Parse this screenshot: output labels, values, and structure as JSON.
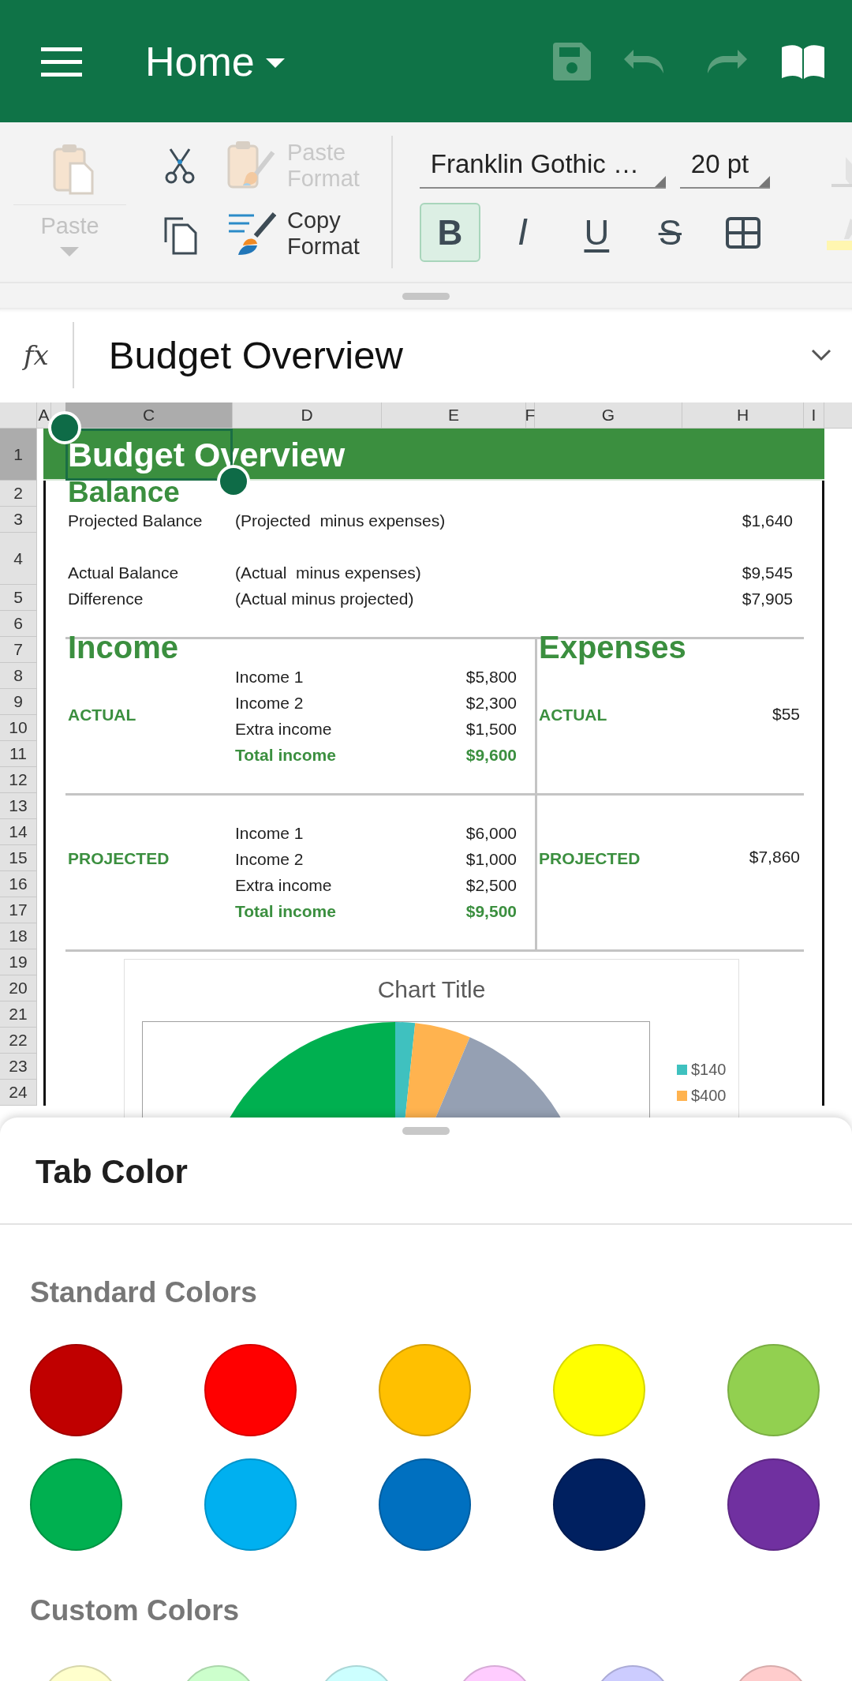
{
  "app_bar": {
    "title": "Home",
    "actions": [
      {
        "kind": "save",
        "disabled": true
      },
      {
        "kind": "undo",
        "disabled": true
      },
      {
        "kind": "redo",
        "disabled": true
      },
      {
        "kind": "read",
        "disabled": false
      }
    ]
  },
  "ribbon": {
    "paste": {
      "label": "Paste",
      "disabled": true
    },
    "tools": [
      {
        "kind": "cut",
        "disabled": false
      },
      {
        "kind": "copy",
        "disabled": false
      }
    ],
    "format_tools": [
      {
        "kind": "paste_format",
        "label": "Paste Format",
        "disabled": true
      },
      {
        "kind": "copy_format",
        "label": "Copy Format",
        "disabled": false
      }
    ],
    "font": {
      "value": "Franklin Gothic …"
    },
    "font_size": {
      "value": "20 pt"
    },
    "styles": [
      {
        "kind": "bold",
        "label": "B",
        "selected": true
      },
      {
        "kind": "italic",
        "label": "I",
        "selected": false
      },
      {
        "kind": "underline",
        "label": "U",
        "selected": false
      },
      {
        "kind": "strike",
        "label": "S",
        "selected": false
      },
      {
        "kind": "borders",
        "selected": false
      }
    ]
  },
  "formula_bar": {
    "label": "fx",
    "value": "Budget Overview"
  },
  "sheet": {
    "columns": [
      {
        "label": "A",
        "selected": false
      },
      {
        "label": "C",
        "selected": true
      },
      {
        "label": "D",
        "selected": false
      },
      {
        "label": "E",
        "selected": false
      },
      {
        "label": "F",
        "selected": false
      },
      {
        "label": "G",
        "selected": false
      },
      {
        "label": "H",
        "selected": false
      },
      {
        "label": "I",
        "selected": false
      }
    ],
    "rows": [
      {
        "label": "1",
        "selected": true
      },
      {
        "label": "2",
        "selected": false
      },
      {
        "label": "3",
        "selected": false
      },
      {
        "label": "4",
        "selected": false
      },
      {
        "label": "5",
        "selected": false
      },
      {
        "label": "6",
        "selected": false
      },
      {
        "label": "7",
        "selected": false
      },
      {
        "label": "8",
        "selected": false
      },
      {
        "label": "9",
        "selected": false
      },
      {
        "label": "10",
        "selected": false
      },
      {
        "label": "11",
        "selected": false
      },
      {
        "label": "12",
        "selected": false
      },
      {
        "label": "13",
        "selected": false
      },
      {
        "label": "14",
        "selected": false
      },
      {
        "label": "15",
        "selected": false
      },
      {
        "label": "16",
        "selected": false
      },
      {
        "label": "17",
        "selected": false
      },
      {
        "label": "18",
        "selected": false
      },
      {
        "label": "19",
        "selected": false
      },
      {
        "label": "20",
        "selected": false
      },
      {
        "label": "21",
        "selected": false
      },
      {
        "label": "22",
        "selected": false
      },
      {
        "label": "23",
        "selected": false
      },
      {
        "label": "24",
        "selected": false
      }
    ],
    "title": "Budget Overview",
    "balance": {
      "heading": "Balance",
      "lines": [
        {
          "label": "Projected Balance",
          "note": "(Projected  minus expenses)",
          "amount": "$1,640"
        },
        {
          "label": "Actual Balance",
          "note": "(Actual  minus expenses)",
          "amount": "$9,545"
        },
        {
          "label": "Difference",
          "note": "(Actual minus projected)",
          "amount": "$7,905"
        }
      ]
    },
    "income": {
      "heading": "Income",
      "groups": [
        {
          "label": "ACTUAL",
          "items": [
            {
              "label": "Income 1",
              "amount": "$5,800"
            },
            {
              "label": "Income 2",
              "amount": "$2,300"
            },
            {
              "label": "Extra income",
              "amount": "$1,500"
            }
          ],
          "total": {
            "label": "Total income",
            "amount": "$9,600"
          }
        },
        {
          "label": "PROJECTED",
          "items": [
            {
              "label": "Income 1",
              "amount": "$6,000"
            },
            {
              "label": "Income 2",
              "amount": "$1,000"
            },
            {
              "label": "Extra income",
              "amount": "$2,500"
            }
          ],
          "total": {
            "label": "Total income",
            "amount": "$9,500"
          }
        }
      ]
    },
    "expenses": {
      "heading": "Expenses",
      "groups": [
        {
          "label": "ACTUAL",
          "amount": "$55"
        },
        {
          "label": "PROJECTED",
          "amount": "$7,860"
        }
      ]
    },
    "chart": {
      "title": "Chart Title",
      "legend": [
        {
          "label": "$140",
          "color": "#3fc1bf"
        },
        {
          "label": "$400",
          "color": "#ffb34f"
        }
      ]
    }
  },
  "tab_color_sheet": {
    "title": "Tab Color",
    "sections": [
      {
        "kind": "standard",
        "heading": "Standard Colors",
        "colors": [
          {
            "color": "#c00000"
          },
          {
            "color": "#ff0000"
          },
          {
            "color": "#ffc000"
          },
          {
            "color": "#ffff00"
          },
          {
            "color": "#92d050"
          },
          {
            "color": "#00b050"
          },
          {
            "color": "#00b0f0"
          },
          {
            "color": "#0070c0"
          },
          {
            "color": "#002060"
          },
          {
            "color": "#7030a0"
          }
        ]
      },
      {
        "kind": "custom",
        "heading": "Custom Colors",
        "colors": [
          {
            "color": "#ffffcc"
          },
          {
            "color": "#ccffcc"
          },
          {
            "color": "#ccffff"
          },
          {
            "color": "#ffccff"
          },
          {
            "color": "#ccccff"
          },
          {
            "color": "#ffcccc"
          }
        ]
      }
    ]
  }
}
